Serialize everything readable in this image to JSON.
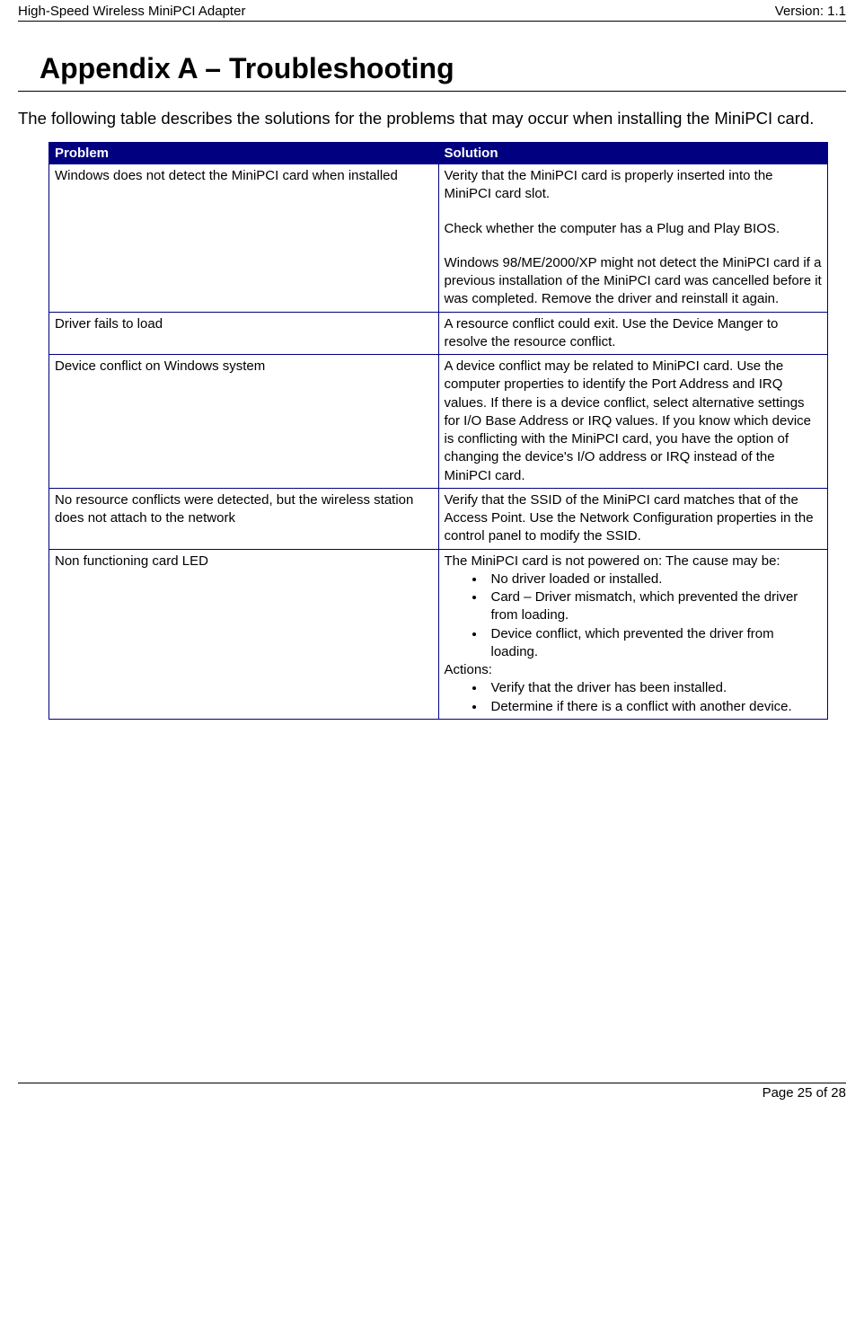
{
  "header": {
    "left": "High-Speed Wireless MiniPCI Adapter",
    "right": "Version: 1.1"
  },
  "title": "Appendix A – Troubleshooting",
  "intro": "The following table describes the solutions for the problems that may occur when installing the MiniPCI card.",
  "table": {
    "col_problem": "Problem",
    "col_solution": "Solution",
    "rows": {
      "r1": {
        "problem": "Windows does not detect the MiniPCI card when installed",
        "sol_p1": "Verity that the MiniPCI card is properly inserted into the MiniPCI card slot.",
        "sol_p2": "Check whether the computer has a Plug and Play BIOS.",
        "sol_p3": "Windows 98/ME/2000/XP might not detect the MiniPCI card if a previous installation of the MiniPCI card was cancelled before it was completed. Remove the driver and reinstall it again."
      },
      "r2": {
        "problem": "Driver fails to load",
        "solution": "A resource conflict could exit.  Use the Device Manger to resolve the resource conflict."
      },
      "r3": {
        "problem": "Device conflict on Windows system",
        "solution": "A device conflict may be related to MiniPCI card.  Use the computer properties to identify the Port Address and IRQ values.  If there is a device conflict, select alternative settings for I/O Base Address or IRQ values.  If you know which device is conflicting with the MiniPCI card, you have the option of changing the device's I/O address or IRQ instead of the MiniPCI card."
      },
      "r4": {
        "problem": "No resource conflicts were detected, but the wireless station does not attach to the network",
        "solution": "Verify that the SSID of the MiniPCI card matches that of the Access Point. Use the Network Configuration properties in the control panel to modify the SSID."
      },
      "r5": {
        "problem": "Non functioning card LED",
        "intro": "The MiniPCI card is not powered on: The cause may be:",
        "b1": "No driver loaded or installed.",
        "b2": "Card – Driver mismatch, which prevented the driver from loading.",
        "b3": "Device conflict, which prevented the driver from loading.",
        "actions_label": "Actions:",
        "a1": "Verify that the driver has been installed.",
        "a2": "Determine if there is a conflict with another device."
      }
    }
  },
  "footer": "Page 25 of 28"
}
